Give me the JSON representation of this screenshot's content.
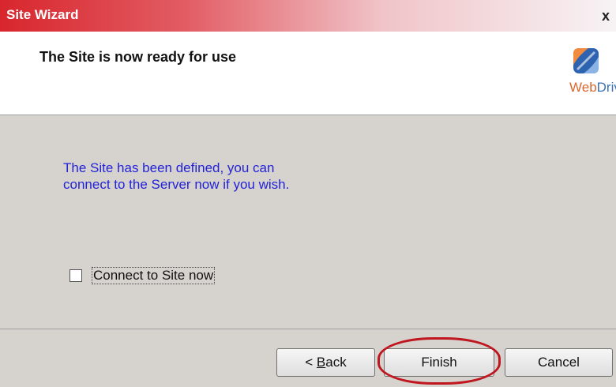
{
  "window": {
    "title": "Site Wizard",
    "close_label": "x"
  },
  "header": {
    "title": "The Site is now ready for use",
    "logo": {
      "icon": "webdrive-logo-icon",
      "text_web": "Web",
      "text_drive": "Drive"
    }
  },
  "body": {
    "info_line1": "The Site has been defined, you can",
    "info_line2": "connect to the Server now if you wish.",
    "connect_checkbox": {
      "label": "Connect to Site now",
      "checked": false
    }
  },
  "footer": {
    "back_accel": "B",
    "back_rest": "ack",
    "back_prefix": "< ",
    "finish_label": "Finish",
    "cancel_label": "Cancel"
  },
  "colors": {
    "title_gradient_start": "#d8262d",
    "info_text": "#2222d8",
    "panel_bg": "#d6d3ce",
    "highlight_ring": "#c0161f"
  }
}
